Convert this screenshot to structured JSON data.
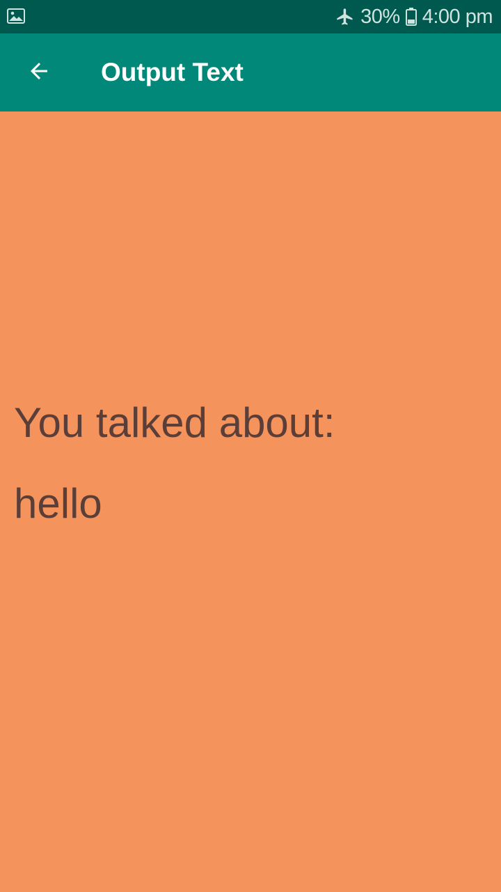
{
  "status_bar": {
    "notification_icon": "image-icon",
    "mode_icon": "airplane-icon",
    "battery_percent": "30%",
    "battery_icon": "battery-icon",
    "time": "4:00 pm"
  },
  "app_bar": {
    "back_icon": "arrow-back-icon",
    "title": "Output Text"
  },
  "content": {
    "label": "You talked about:",
    "value": "hello"
  },
  "colors": {
    "status_bar": "#00594f",
    "app_bar": "#028878",
    "background": "#f5935c",
    "text": "#5b3e38"
  }
}
